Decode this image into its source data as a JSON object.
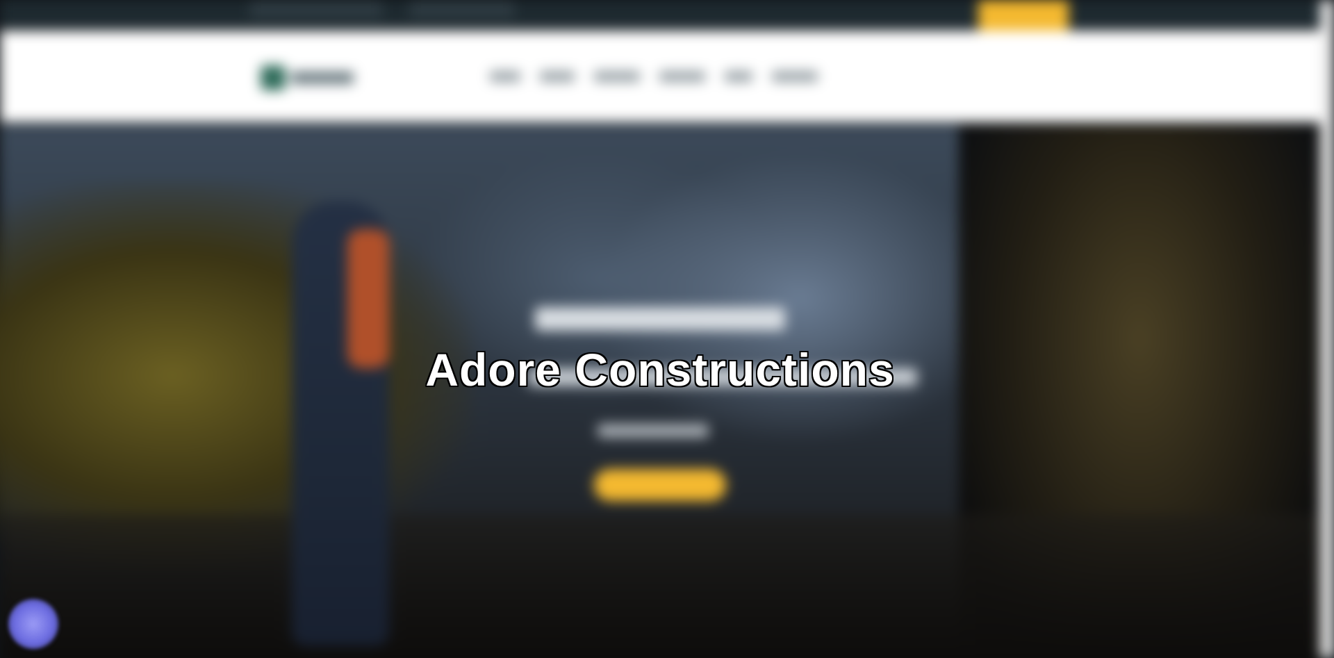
{
  "hero": {
    "title": "Adore Constructions"
  },
  "colors": {
    "topbar_bg": "#1e2a30",
    "accent": "#f4b930",
    "header_bg": "#ffffff",
    "chat_widget": "#7b7bea"
  },
  "icons": {
    "logo": "logo-icon",
    "chat": "chat-icon"
  }
}
